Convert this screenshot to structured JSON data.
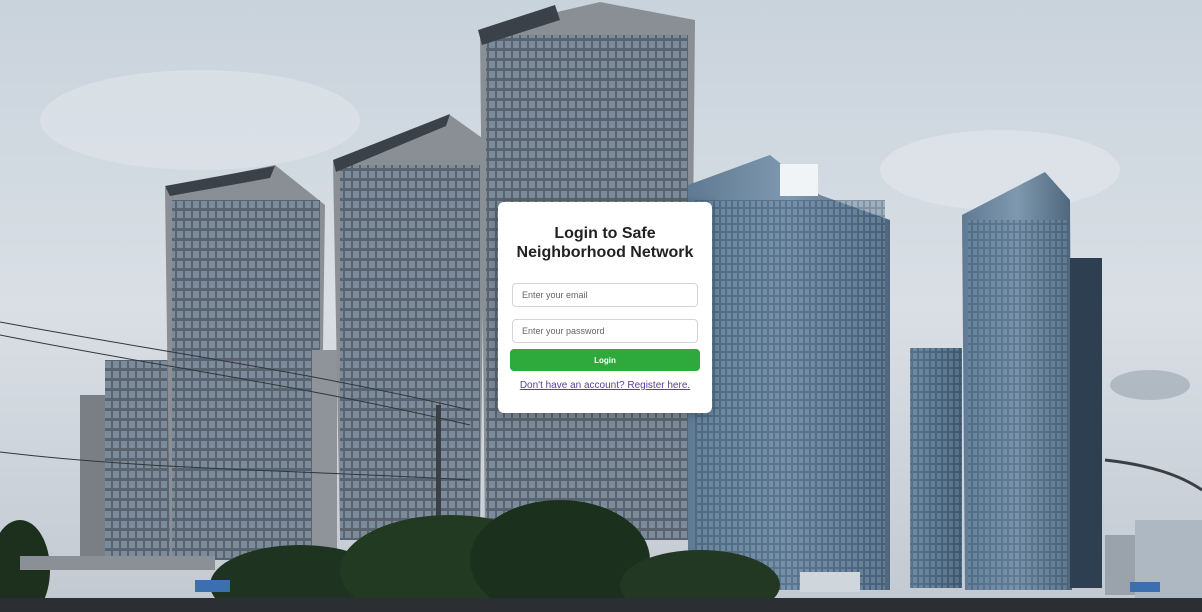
{
  "login": {
    "title": "Login to Safe Neighborhood Network",
    "email_placeholder": "Enter your email",
    "password_placeholder": "Enter your password",
    "login_label": "Login",
    "register_text": "Don't have an account? Register here."
  },
  "colors": {
    "login_button": "#2eaa3d",
    "register_link": "#5b3f9a",
    "card_background": "#ffffff"
  }
}
